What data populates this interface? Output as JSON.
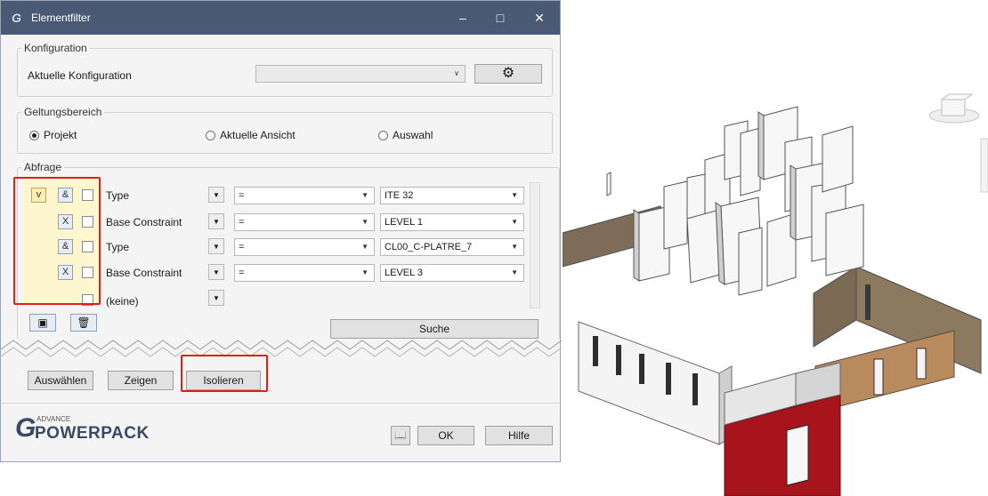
{
  "window": {
    "title": "Elementfilter"
  },
  "konfiguration": {
    "legend": "Konfiguration",
    "label": "Aktuelle Konfiguration",
    "value": ""
  },
  "geltungsbereich": {
    "legend": "Geltungsbereich",
    "options": [
      {
        "label": "Projekt",
        "selected": true
      },
      {
        "label": "Aktuelle Ansicht",
        "selected": false
      },
      {
        "label": "Auswahl",
        "selected": false
      }
    ]
  },
  "abfrage": {
    "legend": "Abfrage",
    "rows": [
      {
        "op": "&",
        "field": "Type",
        "operator": "=",
        "value": "ITE 32"
      },
      {
        "op": "X",
        "field": "Base Constraint",
        "operator": "=",
        "value": "LEVEL 1"
      },
      {
        "op": "&",
        "field": "Type",
        "operator": "=",
        "value": "CL00_C-PLATRE_7"
      },
      {
        "op": "X",
        "field": "Base Constraint",
        "operator": "=",
        "value": "LEVEL 3"
      }
    ],
    "group_label": "v",
    "empty_field": "(keine)",
    "search_label": "Suche"
  },
  "actions": {
    "auswaehlen": "Auswählen",
    "zeigen": "Zeigen",
    "isolieren": "Isolieren"
  },
  "footer": {
    "brand_small": "ADVANCE",
    "brand": "POWERPACK",
    "ok": "OK",
    "hilfe": "Hilfe"
  },
  "colors": {
    "titlebar": "#4a5a74",
    "highlight": "#e01e1e",
    "group_fill": "#fdf6cf",
    "wall_brown": "#a0764a",
    "wall_red": "#a8141c"
  }
}
